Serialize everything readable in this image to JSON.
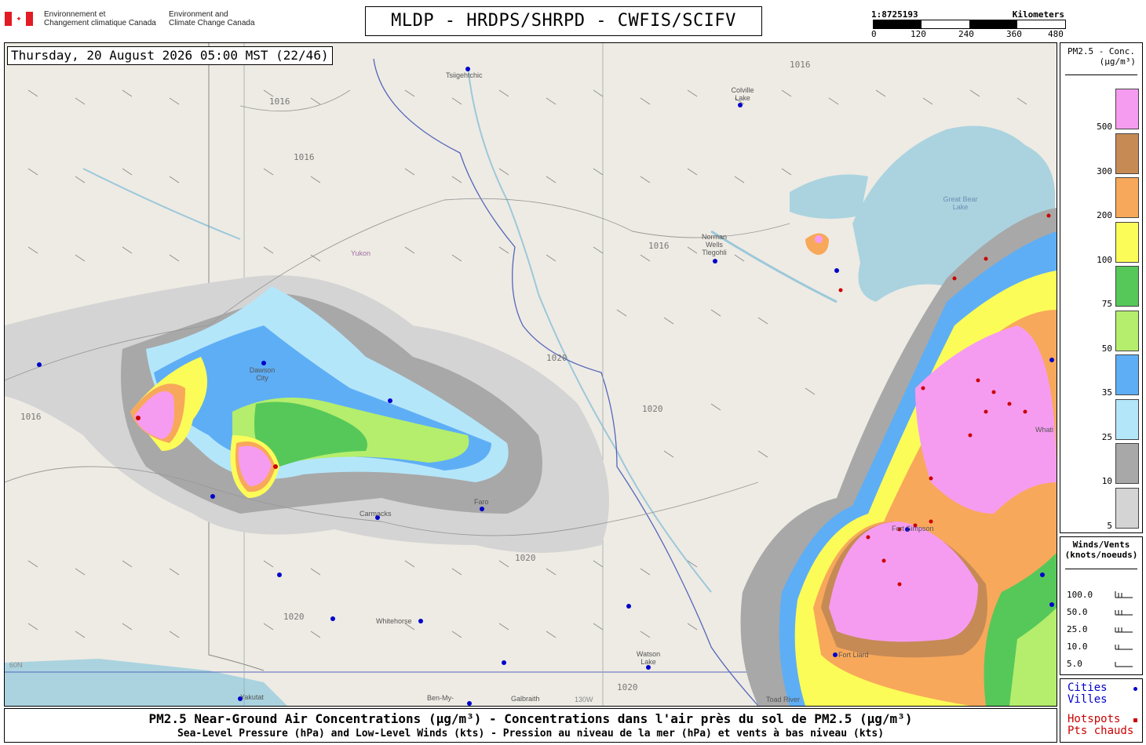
{
  "header": {
    "dept_fr": [
      "Environnement et",
      "Changement climatique Canada"
    ],
    "dept_en": [
      "Environment and",
      "Climate Change Canada"
    ],
    "title": "MLDP - HRDPS/SHRPD - CWFIS/SCIFV",
    "scale_ratio": "1:8725193",
    "scale_unit": "Kilometers",
    "scale_ticks": [
      "0",
      "120",
      "240",
      "360",
      "480"
    ]
  },
  "map": {
    "timestamp": "Thursday, 20 August 2026 05:00 MST (22/46)",
    "places": [
      {
        "name": "Tsiigehtchic",
        "kind": "city"
      },
      {
        "name": "Colville Lake",
        "kind": "city"
      },
      {
        "name": "Great Bear Lake",
        "kind": "water"
      },
      {
        "name": "Norman Wells Tlegohli",
        "kind": "city"
      },
      {
        "name": "Yukon",
        "kind": "region"
      },
      {
        "name": "Dawson City",
        "kind": "city"
      },
      {
        "name": "Carmacks",
        "kind": "city"
      },
      {
        "name": "Faro",
        "kind": "city"
      },
      {
        "name": "Whitehorse",
        "kind": "city"
      },
      {
        "name": "Watson Lake",
        "kind": "city"
      },
      {
        "name": "Fort Liard",
        "kind": "city"
      },
      {
        "name": "Fort Simpson",
        "kind": "city"
      },
      {
        "name": "Whati",
        "kind": "city"
      },
      {
        "name": "Yakutat",
        "kind": "city"
      },
      {
        "name": "Ben-My-",
        "kind": "city"
      },
      {
        "name": "Galbraith",
        "kind": "city"
      },
      {
        "name": "Toad River",
        "kind": "city"
      },
      {
        "name": "130W",
        "kind": "graticule"
      },
      {
        "name": "60N",
        "kind": "graticule"
      }
    ],
    "isobar_labels": [
      "1016",
      "1020"
    ]
  },
  "legend": {
    "title_line1": "PM2.5 - Conc.",
    "title_line2": "(µg/m³)",
    "bins": [
      {
        "label": "500",
        "color": "#f59cf0"
      },
      {
        "label": "300",
        "color": "#c68a55"
      },
      {
        "label": "200",
        "color": "#f8a85a"
      },
      {
        "label": "100",
        "color": "#fcfc58"
      },
      {
        "label": "75",
        "color": "#56c85a"
      },
      {
        "label": "50",
        "color": "#b4ee6c"
      },
      {
        "label": "35",
        "color": "#5eaef6"
      },
      {
        "label": "25",
        "color": "#b4e6fa"
      },
      {
        "label": "10",
        "color": "#a8a8a8"
      },
      {
        "label": "5",
        "color": "#d4d4d4"
      }
    ]
  },
  "winds": {
    "title_line1": "Winds/Vents",
    "title_line2": "(knots/noeuds)",
    "rows": [
      "100.0",
      "50.0",
      "25.0",
      "10.0",
      "5.0"
    ]
  },
  "markers": {
    "cities_en": "Cities",
    "cities_fr": "Villes",
    "hotspots_en": "Hotspots",
    "hotspots_fr": "Pts chauds",
    "city_color": "#0000cc",
    "hotspot_color": "#cc0000"
  },
  "caption": {
    "main": "PM2.5 Near-Ground Air Concentrations (µg/m³) - Concentrations dans l'air près du sol de PM2.5 (µg/m³)",
    "sub": "Sea-Level Pressure (hPa) and Low-Level Winds (kts) - Pression au niveau de la mer (hPa) et vents à bas niveau (kts)"
  }
}
